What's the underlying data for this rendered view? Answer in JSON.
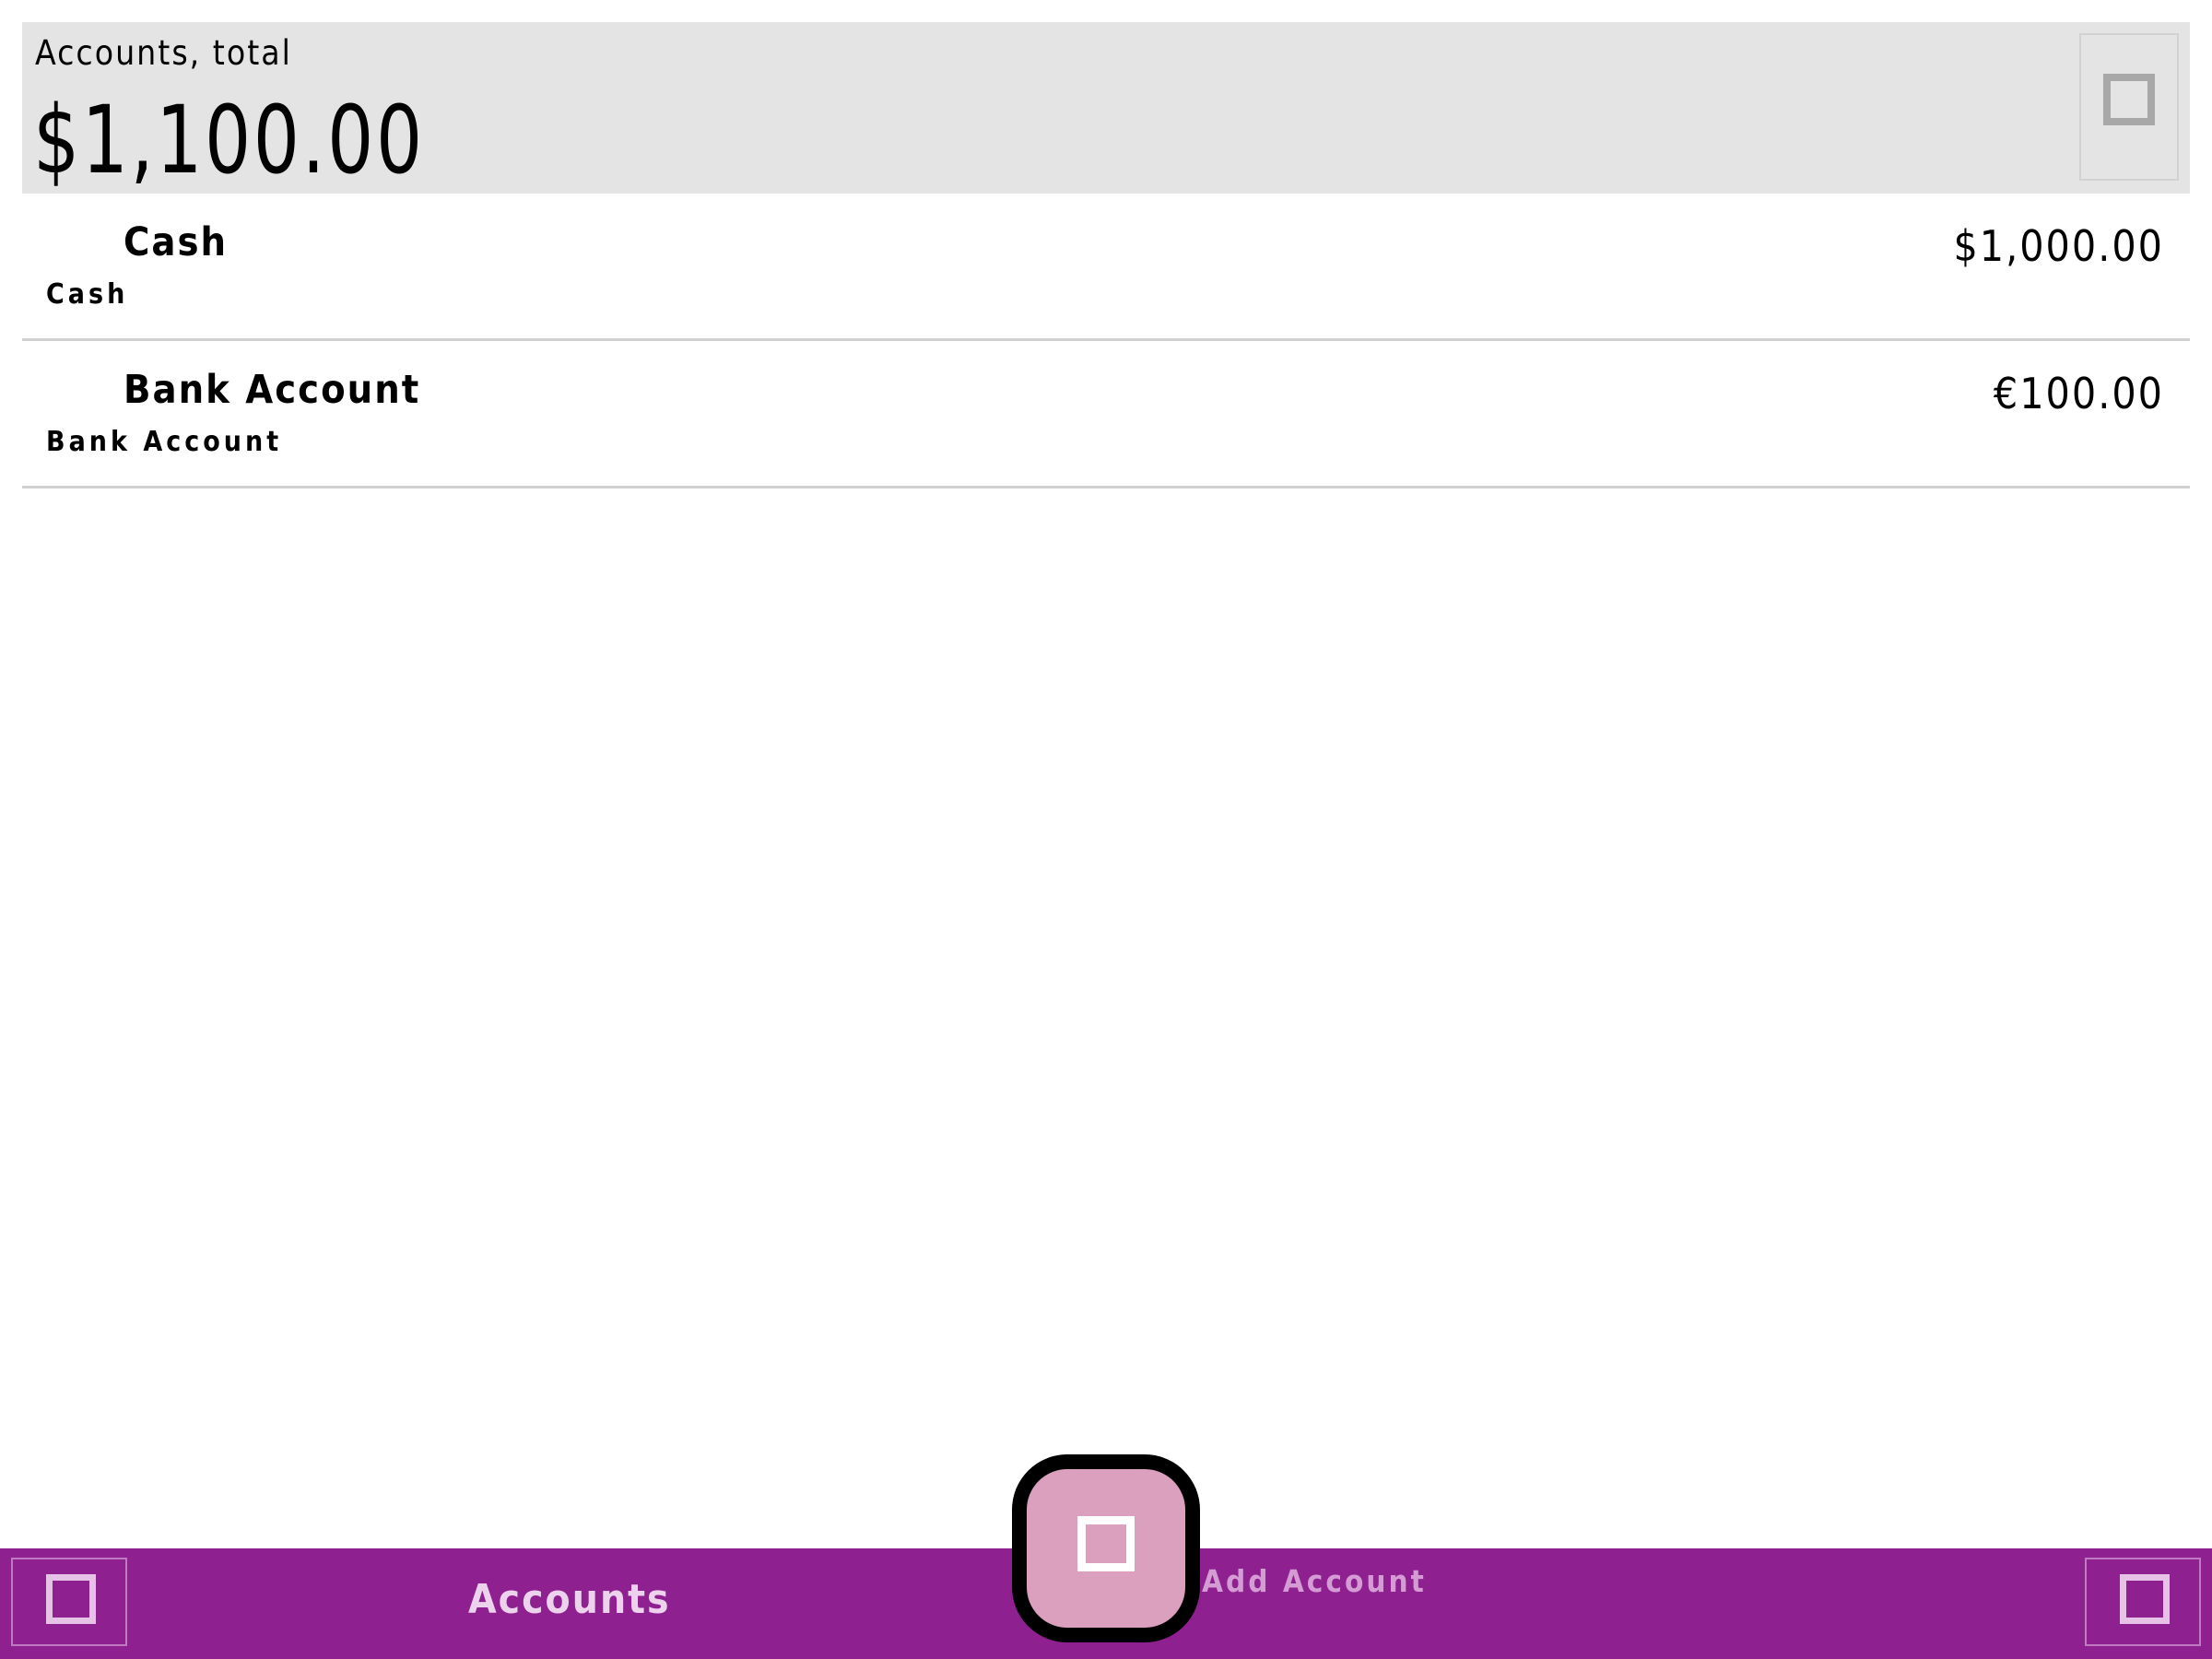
{
  "header": {
    "total_label": "Accounts, total",
    "total_value": "$1,100.00",
    "action_icon": "square-icon"
  },
  "accounts": [
    {
      "name": "Cash",
      "type": "Cash",
      "balance": "$1,000.00"
    },
    {
      "name": "Bank Account",
      "type": "Bank Account",
      "balance": "€100.00"
    }
  ],
  "bottom_bar": {
    "title": "Accounts",
    "fab_label": "Add Account",
    "left_icon": "square-icon",
    "right_icon": "square-icon"
  },
  "colors": {
    "header_background": "#e4e4e4",
    "bar_background": "#8e208f",
    "fab_background": "#dba0bd",
    "divider": "#d0d0d0"
  }
}
